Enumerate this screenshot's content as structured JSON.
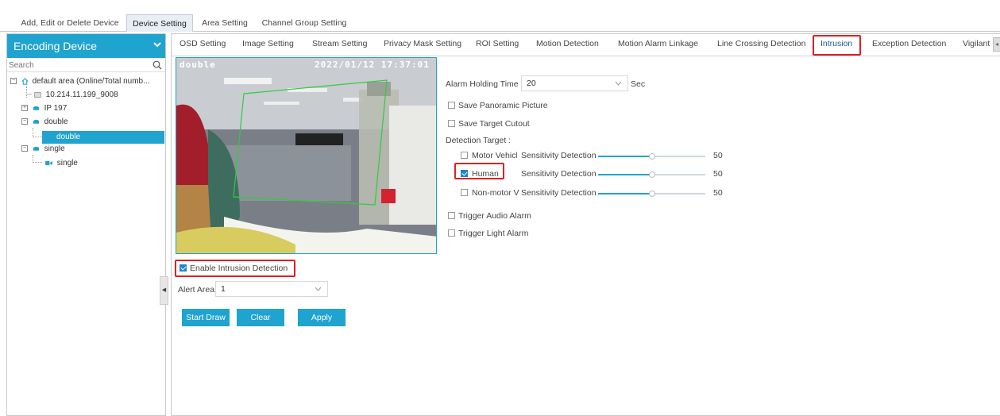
{
  "top_tabs": [
    "Add, Edit or Delete Device",
    "Device Setting",
    "Area Setting",
    "Channel Group Setting"
  ],
  "left": {
    "title": "Encoding Device",
    "search_placeholder": "Search",
    "tree": {
      "area": "default area (Online/Total numb...",
      "ip1": "10.214.11.199_9008",
      "ip2": "IP 197",
      "double_group": "double",
      "double_child": "double",
      "single_group": "single",
      "single_child": "single"
    }
  },
  "sub_tabs": [
    "OSD Setting",
    "Image Setting",
    "Stream Setting",
    "Privacy Mask Setting",
    "ROI Setting",
    "Motion Detection",
    "Motion Alarm Linkage",
    "Line Crossing Detection",
    "Intrusion",
    "Exception Detection",
    "Vigilant"
  ],
  "preview": {
    "osd_name": "double",
    "osd_time": "2022/01/12 17:37:01"
  },
  "enable_intrusion_label": "Enable Intrusion Detection",
  "alert_area": {
    "label": "Alert Area",
    "value": "1"
  },
  "buttons": {
    "start_draw": "Start Draw",
    "clear": "Clear",
    "apply": "Apply"
  },
  "settings": {
    "alarm_holding_label": "Alarm Holding Time",
    "alarm_holding_value": "20",
    "alarm_holding_unit": "Sec",
    "save_panoramic": "Save Panoramic Picture",
    "save_target": "Save Target Cutout",
    "detection_target": "Detection Target :",
    "targets": [
      {
        "name": "Motor Vehicl",
        "checked": false,
        "sens_label": "Sensitivity Detection",
        "value": "50",
        "level": 0.5
      },
      {
        "name": "Human",
        "checked": true,
        "sens_label": "Sensitivity Detection",
        "value": "50",
        "level": 0.5
      },
      {
        "name": "Non-motor V",
        "checked": false,
        "sens_label": "Sensitivity Detection",
        "value": "50",
        "level": 0.5
      }
    ],
    "trigger_audio": "Trigger Audio Alarm",
    "trigger_light": "Trigger Light Alarm"
  },
  "colors": {
    "accent": "#1fa3cf",
    "highlight": "#e02020",
    "check": "#1f86c8"
  }
}
